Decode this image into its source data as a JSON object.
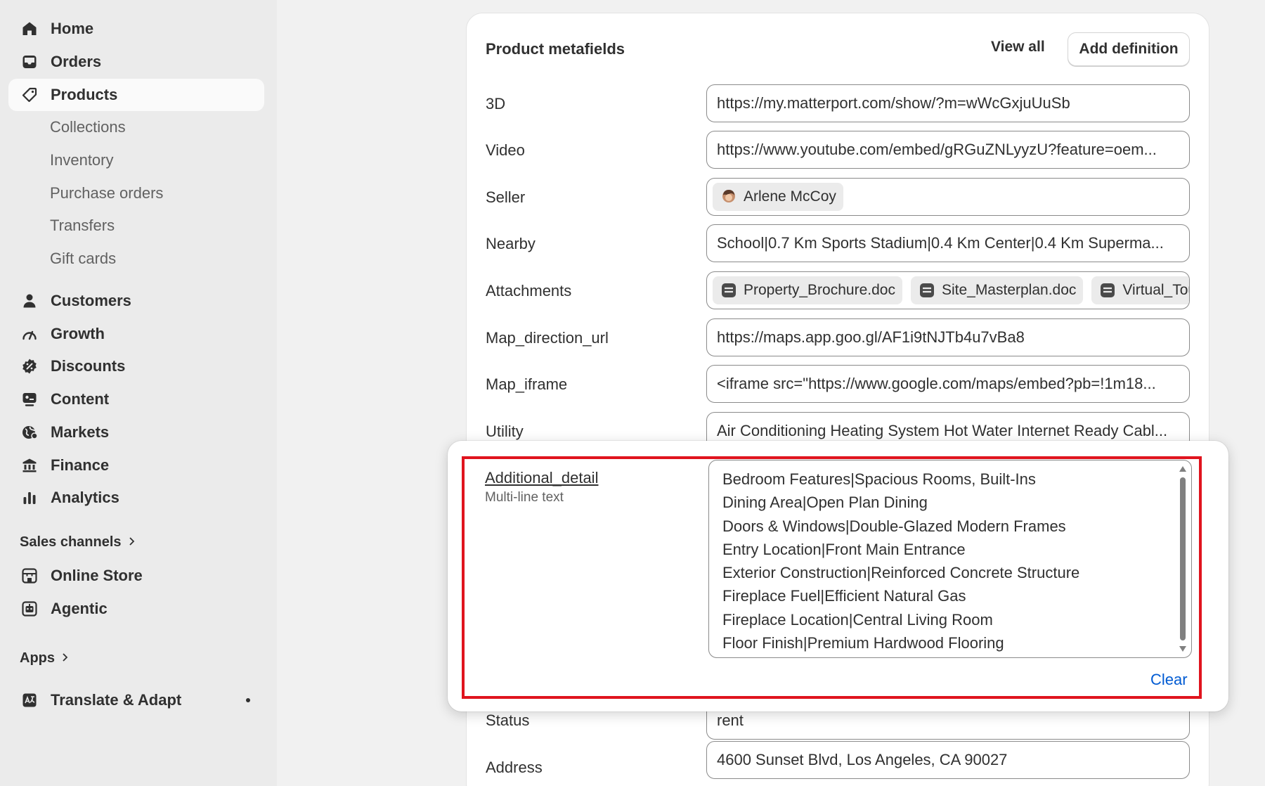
{
  "sidebar": {
    "items": [
      {
        "label": "Home",
        "icon": "home-icon"
      },
      {
        "label": "Orders",
        "icon": "inbox-icon"
      },
      {
        "label": "Products",
        "icon": "tag-icon"
      },
      {
        "label": "Collections"
      },
      {
        "label": "Inventory"
      },
      {
        "label": "Purchase orders"
      },
      {
        "label": "Transfers"
      },
      {
        "label": "Gift cards"
      },
      {
        "label": "Customers",
        "icon": "person-icon"
      },
      {
        "label": "Growth",
        "icon": "gauge-icon"
      },
      {
        "label": "Discounts",
        "icon": "discount-icon"
      },
      {
        "label": "Content",
        "icon": "content-icon"
      },
      {
        "label": "Markets",
        "icon": "globe-icon"
      },
      {
        "label": "Finance",
        "icon": "bank-icon"
      },
      {
        "label": "Analytics",
        "icon": "bar-chart-icon"
      }
    ],
    "sales_channels_label": "Sales channels",
    "channels": [
      {
        "label": "Online Store",
        "icon": "store-icon"
      },
      {
        "label": "Agentic",
        "icon": "robot-icon"
      }
    ],
    "apps_label": "Apps",
    "apps": [
      {
        "label": "Translate & Adapt",
        "icon": "translate-icon"
      }
    ]
  },
  "metafields": {
    "title": "Product metafields",
    "view_all": "View all",
    "add_definition": "Add definition",
    "rows": [
      {
        "label": "3D",
        "value": "https://my.matterport.com/show/?m=wWcGxjuUuSb"
      },
      {
        "label": "Video",
        "value": "https://www.youtube.com/embed/gRGuZNLyyzU?feature=oem..."
      },
      {
        "label": "Seller",
        "chip": "Arlene McCoy"
      },
      {
        "label": "Nearby",
        "value": "School|0.7 Km Sports Stadium|0.4 Km Center|0.4 Km Superma..."
      },
      {
        "label": "Attachments",
        "files": [
          "Property_Brochure.doc",
          "Site_Masterplan.doc",
          "Virtual_Tou"
        ]
      },
      {
        "label": "Map_direction_url",
        "value": "https://maps.app.goo.gl/AF1i9tNJTb4u7vBa8"
      },
      {
        "label": "Map_iframe",
        "value": "<iframe src=\"https://www.google.com/maps/embed?pb=!1m18..."
      },
      {
        "label": "Utility",
        "value": "Air Conditioning Heating System Hot Water Internet Ready Cabl..."
      },
      {
        "label": "Status",
        "value": "rent"
      },
      {
        "label": "Address",
        "value": "4600 Sunset Blvd, Los Angeles, CA 90027"
      }
    ]
  },
  "popover": {
    "label": "Additional_detail",
    "type": "Multi-line text",
    "lines": [
      "Bedroom Features|Spacious Rooms, Built-Ins",
      "Dining Area|Open Plan Dining",
      "Doors & Windows|Double-Glazed Modern Frames",
      "Entry Location|Front Main Entrance",
      "Exterior Construction|Reinforced Concrete Structure",
      "Fireplace Fuel|Efficient Natural Gas",
      "Fireplace Location|Central Living Room",
      "Floor Finish|Premium Hardwood Flooring"
    ],
    "clear": "Clear"
  }
}
